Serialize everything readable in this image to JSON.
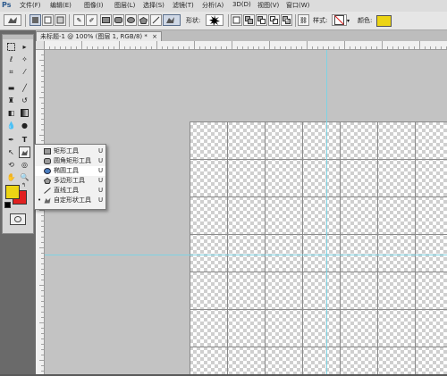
{
  "app": {
    "logo": "Ps"
  },
  "menu": [
    "文件(F)",
    "编辑(E)",
    "图像(I)",
    "图层(L)",
    "选择(S)",
    "滤镜(T)",
    "分析(A)",
    "3D(D)",
    "视图(V)",
    "窗口(W)"
  ],
  "options_bar": {
    "shape_label": "形状:",
    "style_label": "样式:",
    "color_label": "颜色:",
    "color": "#ecd414"
  },
  "document_tab": {
    "title": "未标题-1 @ 100% (图层 1, RGB/8) *"
  },
  "toolbox": {
    "foreground_color": "#ecd414",
    "background_color": "#e02020"
  },
  "flyout": {
    "items": [
      {
        "label": "矩形工具",
        "key": "U",
        "icon": "rectangle-icon",
        "selected": false
      },
      {
        "label": "圆角矩形工具",
        "key": "U",
        "icon": "rounded-rectangle-icon",
        "selected": false
      },
      {
        "label": "椭圆工具",
        "key": "U",
        "icon": "ellipse-icon",
        "selected": false
      },
      {
        "label": "多边形工具",
        "key": "U",
        "icon": "polygon-icon",
        "selected": false
      },
      {
        "label": "直线工具",
        "key": "U",
        "icon": "line-icon",
        "selected": false
      },
      {
        "label": "自定形状工具",
        "key": "U",
        "icon": "custom-shape-icon",
        "selected": true
      }
    ]
  },
  "colors": {
    "guide": "#7fd3e3",
    "workspace": "#c3c3c3"
  }
}
